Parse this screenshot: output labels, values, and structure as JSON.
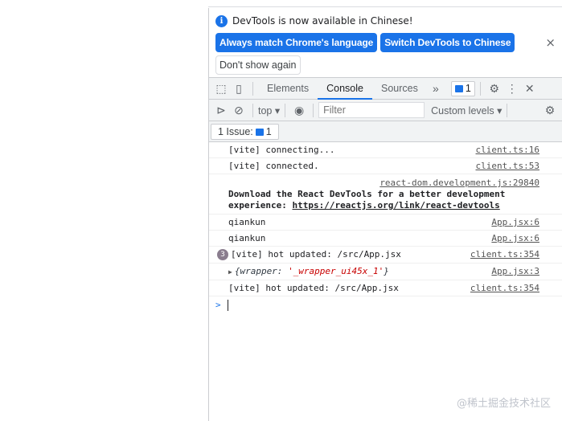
{
  "infobar": {
    "message": "DevTools is now available in Chinese!",
    "btn_match": "Always match Chrome's language",
    "btn_switch": "Switch DevTools to Chinese",
    "btn_dont_show": "Don't show again",
    "close": "×"
  },
  "tabs": {
    "items": [
      "Elements",
      "Console",
      "Sources"
    ],
    "active": "Console",
    "more": "»",
    "issues_count": "1"
  },
  "console_toolbar": {
    "context": "top",
    "filter_placeholder": "Filter",
    "levels": "Custom levels"
  },
  "issues": {
    "label": "1 Issue:",
    "count": "1"
  },
  "messages": [
    {
      "text": "[vite] connecting...",
      "source": "client.ts:16"
    },
    {
      "text": "[vite] connected.",
      "source": "client.ts:53"
    },
    {
      "source": "react-dom.development.js:29840",
      "text": "Download the React DevTools for a better development experience: ",
      "link": "https://reactjs.org/link/react-devtools"
    },
    {
      "text": "qiankun",
      "source": "App.jsx:6"
    },
    {
      "text": "qiankun",
      "source": "App.jsx:6"
    },
    {
      "repeat": "3",
      "text": "[vite] hot updated: /src/App.jsx",
      "source": "client.ts:354"
    },
    {
      "obj_key": "{wrapper: ",
      "obj_val": "'_wrapper_ui45x_1'",
      "obj_end": "}",
      "source": "App.jsx:3"
    },
    {
      "text": "[vite] hot updated: /src/App.jsx",
      "source": "client.ts:354"
    }
  ],
  "prompt": ">",
  "watermark": "@稀土掘金技术社区",
  "colors": {
    "accent": "#1a73e8",
    "string": "#c80000"
  }
}
